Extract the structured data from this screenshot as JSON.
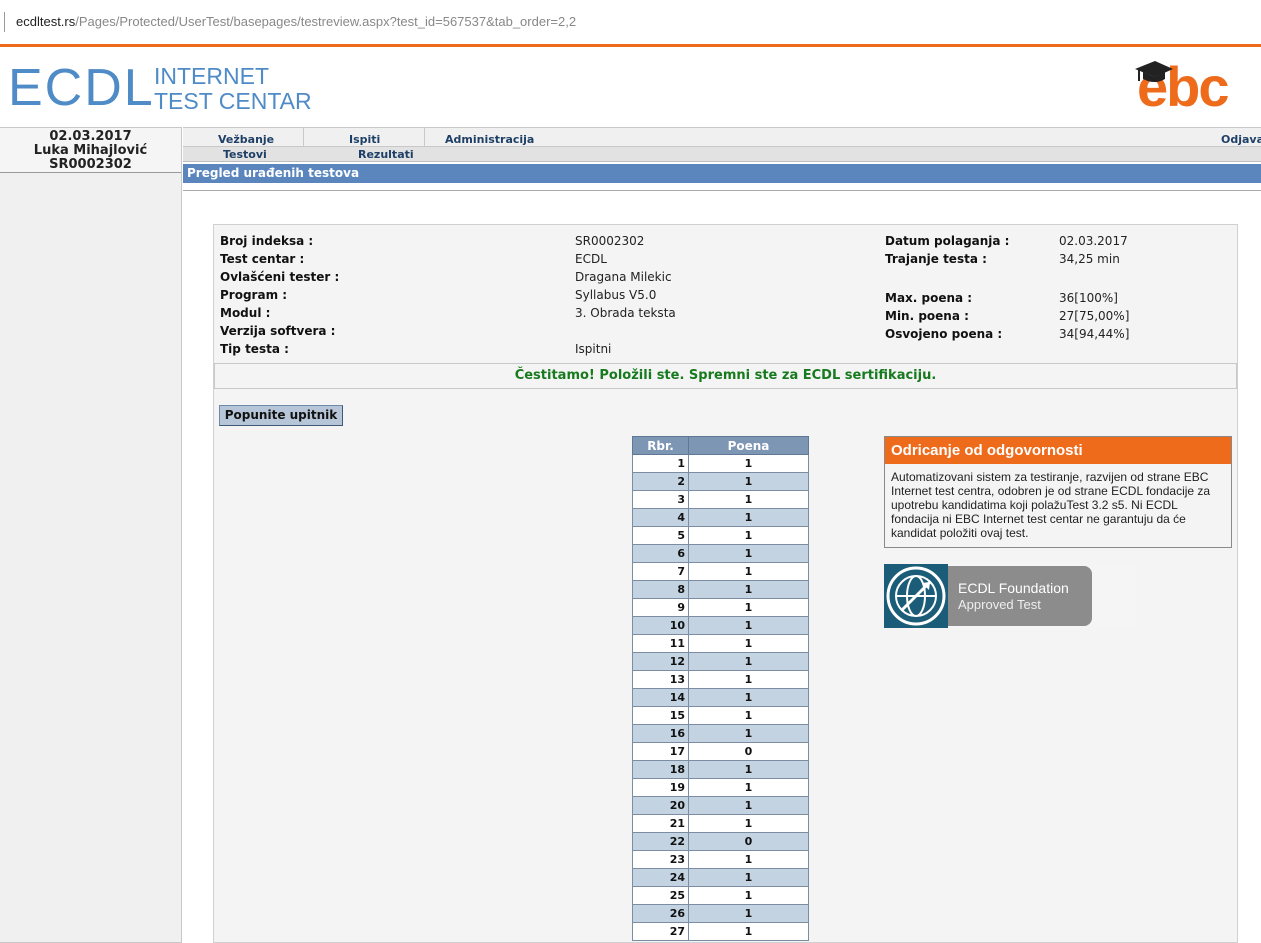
{
  "address_bar": {
    "host": "ecdltest.rs",
    "path": "/Pages/Protected/UserTest/basepages/testreview.aspx?test_id=567537&tab_order=2,2"
  },
  "logo": {
    "big": "ECDL",
    "line1": "INTERNET",
    "line2": "TEST CENTAR"
  },
  "brand": {
    "text": "ebc",
    "color": "#ef6b1c"
  },
  "user": {
    "date": "02.03.2017",
    "name": "Luka Mihajlović",
    "id": "SR0002302"
  },
  "menu": {
    "top": [
      "Vežbanje",
      "Ispiti",
      "Administracija"
    ],
    "logout": "Odjava",
    "sub": [
      "Testovi",
      "Rezultati"
    ]
  },
  "page_title": "Pregled urađenih testova",
  "info": {
    "left": [
      {
        "label": "Broj indeksa :",
        "value": "SR0002302"
      },
      {
        "label": "Test centar :",
        "value": "ECDL"
      },
      {
        "label": "Ovlašćeni tester :",
        "value": "Dragana Milekic"
      },
      {
        "label": "Program :",
        "value": "Syllabus V5.0"
      },
      {
        "label": "Modul :",
        "value": "3. Obrada teksta"
      },
      {
        "label": "Verzija softvera :",
        "value": ""
      },
      {
        "label": "Tip testa :",
        "value": "Ispitni"
      }
    ],
    "right": [
      {
        "label": "Datum polaganja :",
        "value": "02.03.2017"
      },
      {
        "label": "Trajanje testa :",
        "value": "34,25 min"
      },
      {
        "label": "Max. poena :",
        "value": "36[100%]"
      },
      {
        "label": "Min. poena :",
        "value": "27[75,00%]"
      },
      {
        "label": "Osvojeno poena :",
        "value": "34[94,44%]"
      }
    ]
  },
  "congrats": "Čestitamo! Položili ste. Spremni ste za ECDL sertifikaciju.",
  "button_label": "Popunite upitnik",
  "table": {
    "headers": [
      "Rbr.",
      "Poena"
    ],
    "rows": [
      [
        "1",
        "1"
      ],
      [
        "2",
        "1"
      ],
      [
        "3",
        "1"
      ],
      [
        "4",
        "1"
      ],
      [
        "5",
        "1"
      ],
      [
        "6",
        "1"
      ],
      [
        "7",
        "1"
      ],
      [
        "8",
        "1"
      ],
      [
        "9",
        "1"
      ],
      [
        "10",
        "1"
      ],
      [
        "11",
        "1"
      ],
      [
        "12",
        "1"
      ],
      [
        "13",
        "1"
      ],
      [
        "14",
        "1"
      ],
      [
        "15",
        "1"
      ],
      [
        "16",
        "1"
      ],
      [
        "17",
        "0"
      ],
      [
        "18",
        "1"
      ],
      [
        "19",
        "1"
      ],
      [
        "20",
        "1"
      ],
      [
        "21",
        "1"
      ],
      [
        "22",
        "0"
      ],
      [
        "23",
        "1"
      ],
      [
        "24",
        "1"
      ],
      [
        "25",
        "1"
      ],
      [
        "26",
        "1"
      ],
      [
        "27",
        "1"
      ]
    ]
  },
  "disclaimer": {
    "title": "Odricanje od odgovornosti",
    "text": "Automatizovani sistem za testiranje, razvijen od strane EBC Internet test centra, odobren je od strane ECDL fondacije za upotrebu kandidatima koji polažuTest 3.2 s5. Ni ECDL fondacija ni EBC Internet test centar ne garantuju da će kandidat položiti ovaj test."
  },
  "badge": {
    "line1": "ECDL Foundation",
    "line2": "Approved Test"
  }
}
